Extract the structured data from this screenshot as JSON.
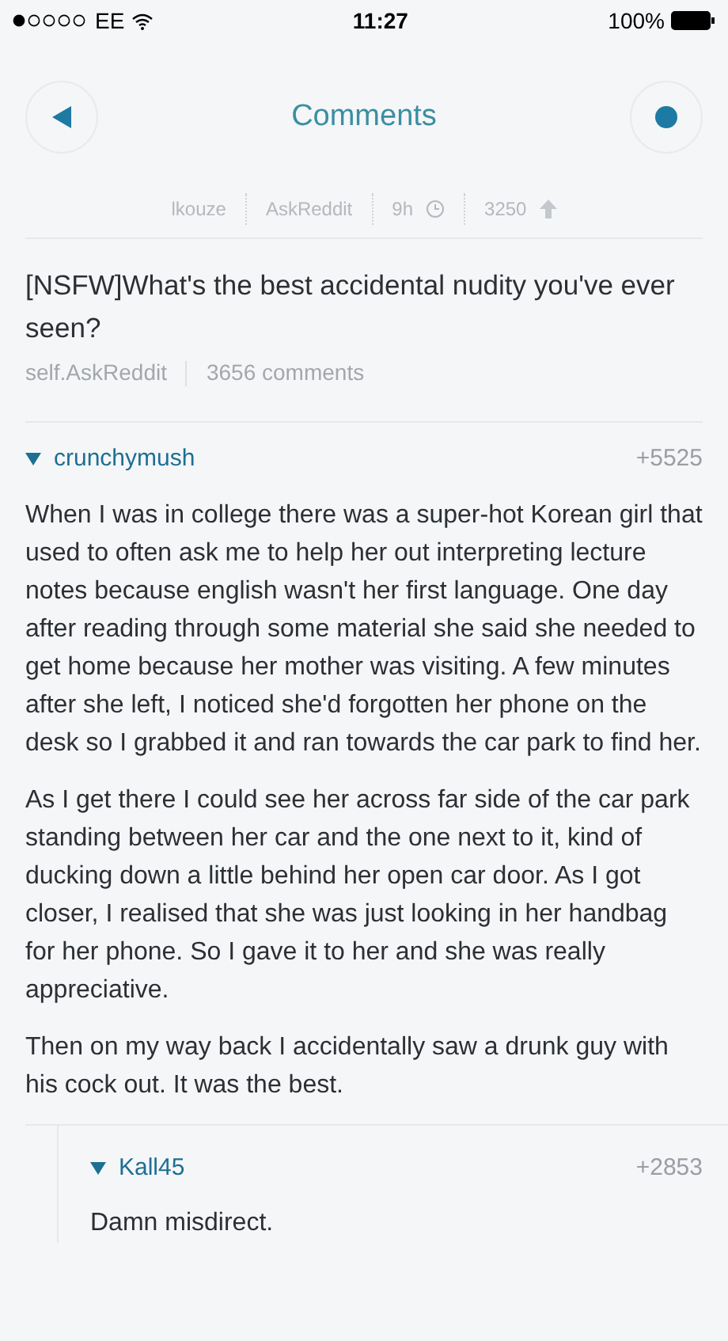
{
  "status_bar": {
    "carrier": "EE",
    "time": "11:27",
    "battery": "100%"
  },
  "nav": {
    "title": "Comments"
  },
  "post": {
    "meta": [
      {
        "kind": "text",
        "text": "lkouze"
      },
      {
        "kind": "text",
        "text": "AskReddit"
      },
      {
        "kind": "time",
        "text": "9h"
      },
      {
        "kind": "score",
        "text": "3250"
      }
    ],
    "title": "[NSFW]What's the best accidental nudity you've ever seen?",
    "domain": "self.AskReddit",
    "comments": "3656 comments"
  },
  "comments": [
    {
      "author": "crunchymush",
      "score": "+5525",
      "expanded": true,
      "paragraphs": [
        "When I was in college there was a super-hot Korean girl that used to often ask me to help her out interpreting lecture notes because english wasn't her first language. One day after reading through some material she said she needed to get home because her mother was visiting. A few minutes after she left, I noticed she'd forgotten her phone on the desk so I grabbed it and ran towards the car park to find her.",
        "As I get there I could see her across far side of the car park standing between her car and the one next to it, kind of ducking down a little behind her open car door. As I got closer, I realised that she was just looking in her handbag for her phone. So I gave it to her and she was really appreciative.",
        "Then on my way back I accidentally saw a drunk guy with his cock out. It was the best."
      ],
      "replies": [
        {
          "author": "Kall45",
          "score": "+2853",
          "expanded": true,
          "paragraphs": [
            "Damn misdirect."
          ]
        }
      ]
    }
  ]
}
